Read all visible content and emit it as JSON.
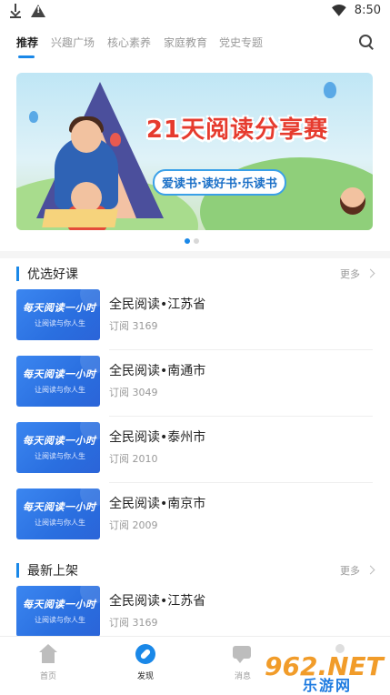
{
  "status_bar": {
    "time": "8:50"
  },
  "tabs": {
    "items": [
      "推荐",
      "兴趣广场",
      "核心素养",
      "家庭教育",
      "党史专题"
    ],
    "active": "推荐"
  },
  "banner": {
    "title": "21天阅读分享赛",
    "subtitle": "爱读书·读好书·乐读书"
  },
  "carousel": {
    "pages": 2,
    "current": 1
  },
  "section_courses": {
    "title": "优选好课",
    "more": "更多",
    "items": [
      {
        "name": "全民阅读•江苏省",
        "subs": "订阅 3169",
        "thumb_title": "每天阅读一小时",
        "thumb_sub": "让阅读与你人生"
      },
      {
        "name": "全民阅读•南通市",
        "subs": "订阅 3049",
        "thumb_title": "每天阅读一小时",
        "thumb_sub": "让阅读与你人生"
      },
      {
        "name": " 全民阅读•泰州市",
        "subs": "订阅 2010",
        "thumb_title": "每天阅读一小时",
        "thumb_sub": "让阅读与你人生"
      },
      {
        "name": "全民阅读•南京市",
        "subs": "订阅 2009",
        "thumb_title": "每天阅读一小时",
        "thumb_sub": "让阅读与你人生"
      }
    ]
  },
  "section_new": {
    "title": "最新上架",
    "more": "更多",
    "items": [
      {
        "name": "全民阅读•江苏省",
        "subs": "订阅 3169",
        "thumb_title": "每天阅读一小时",
        "thumb_sub": "让阅读与你人生"
      }
    ]
  },
  "bottom_nav": {
    "items": [
      {
        "label": "首页",
        "icon": "home-icon"
      },
      {
        "label": "发现",
        "icon": "compass-icon",
        "active": true
      },
      {
        "label": "消息",
        "icon": "message-icon"
      },
      {
        "label": "",
        "icon": "profile-icon"
      }
    ]
  },
  "watermark": {
    "logo": "962.NET",
    "text": "乐游网"
  },
  "colors": {
    "accent": "#1a88e8",
    "banner_title": "#e63b2e"
  }
}
